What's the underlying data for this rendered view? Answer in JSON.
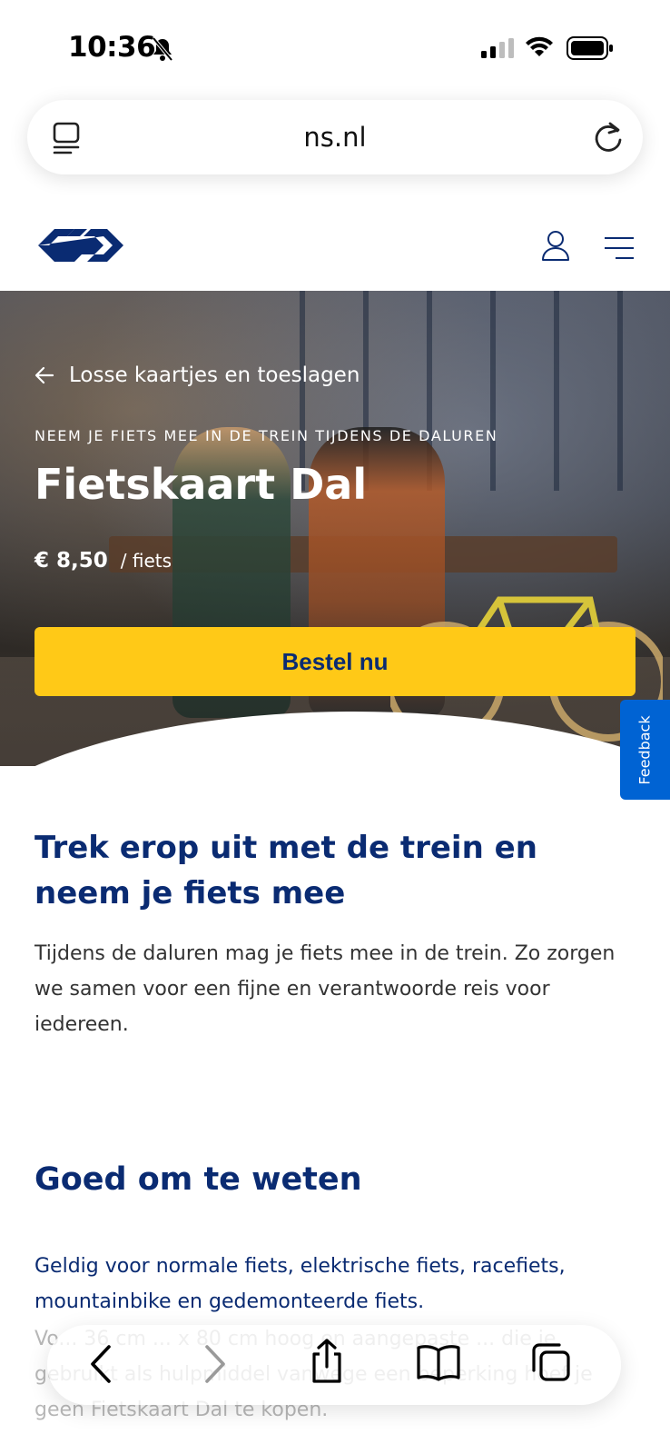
{
  "status_bar": {
    "time": "10:36"
  },
  "browser": {
    "url": "ns.nl"
  },
  "hero": {
    "back_label": "Losse kaartjes en toeslagen",
    "eyebrow": "NEEM JE FIETS MEE IN DE TREIN TIJDENS DE DALUREN",
    "title": "Fietskaart Dal",
    "price": "€ 8,50",
    "price_unit": "/ fiets",
    "order_button": "Bestel nu"
  },
  "feedback_tab": "Feedback",
  "intro": {
    "heading": "Trek erop uit met de trein en neem je fiets mee",
    "text": "Tijdens de daluren mag je fiets mee in de trein. Zo zorgen we samen voor een fijne en verantwoorde reis voor iedereen."
  },
  "good_to_know": {
    "heading": "Goed om te weten",
    "valid_for": "Geldig voor normale fiets, elektrische fiets, racefiets, mountainbike en gedemonteerde fiets.",
    "faded_text": "Vo... 36 cm ... x 80 cm hoog en aangepaste ... die je gebruikt als hulpmiddel vanwege een beperking hoef je geen Fietskaart Dal te kopen."
  },
  "colors": {
    "ns_blue": "#0a2b72",
    "ns_yellow": "#ffc917",
    "feedback_blue": "#0063d3"
  },
  "icons": {
    "tab_icon": "tab-overview-icon",
    "reload": "reload-icon",
    "account": "account-icon",
    "menu": "hamburger-menu-icon",
    "back": "arrow-left-icon"
  }
}
